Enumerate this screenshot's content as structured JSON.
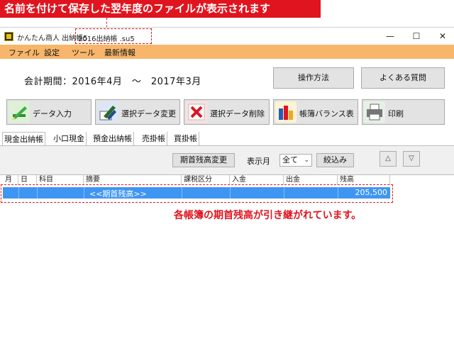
{
  "callout": {
    "top": "名前を付けて保存した翌年度のファイルが表示されます",
    "note": "各帳簿の期首残高が引き継がれています。"
  },
  "window": {
    "app_title": "かんたん商人 出納帳5",
    "file_name": "2016出納帳 .su5",
    "minimize": "—",
    "maximize": "☐",
    "close": "✕"
  },
  "menu": [
    "ファイル",
    "設定",
    "ツール",
    "最新情報"
  ],
  "period": "会計期間：2016年4月　～　2017年3月",
  "top_buttons": {
    "howto": "操作方法",
    "faq": "よくある質問"
  },
  "toolbar": [
    {
      "label": "データ入力",
      "icon": "pencil-icon"
    },
    {
      "label": "選択データ変更",
      "icon": "edit-icon"
    },
    {
      "label": "選択データ削除",
      "icon": "delete-x-icon"
    },
    {
      "label": "帳簿バランス表",
      "icon": "bar-chart-icon"
    },
    {
      "label": "印刷",
      "icon": "printer-icon"
    }
  ],
  "tabs": [
    "現金出納帳",
    "小口現金",
    "預金出納帳",
    "売掛帳",
    "買掛帳"
  ],
  "filter": {
    "balance_button": "期首残高変更",
    "month_label": "表示月",
    "month_value": "全て",
    "narrow_button": "絞込み",
    "up": "△",
    "down": "▽"
  },
  "table": {
    "columns": [
      "月",
      "日",
      "科目",
      "摘要",
      "課税区分",
      "入金",
      "出金",
      "残高"
    ],
    "rows": [
      {
        "summary": "<<期首残高>>",
        "balance": "205,500"
      }
    ]
  },
  "colors": {
    "accent": "#e0141e",
    "menubar": "#f7b66b",
    "selection": "#3f96f2"
  }
}
